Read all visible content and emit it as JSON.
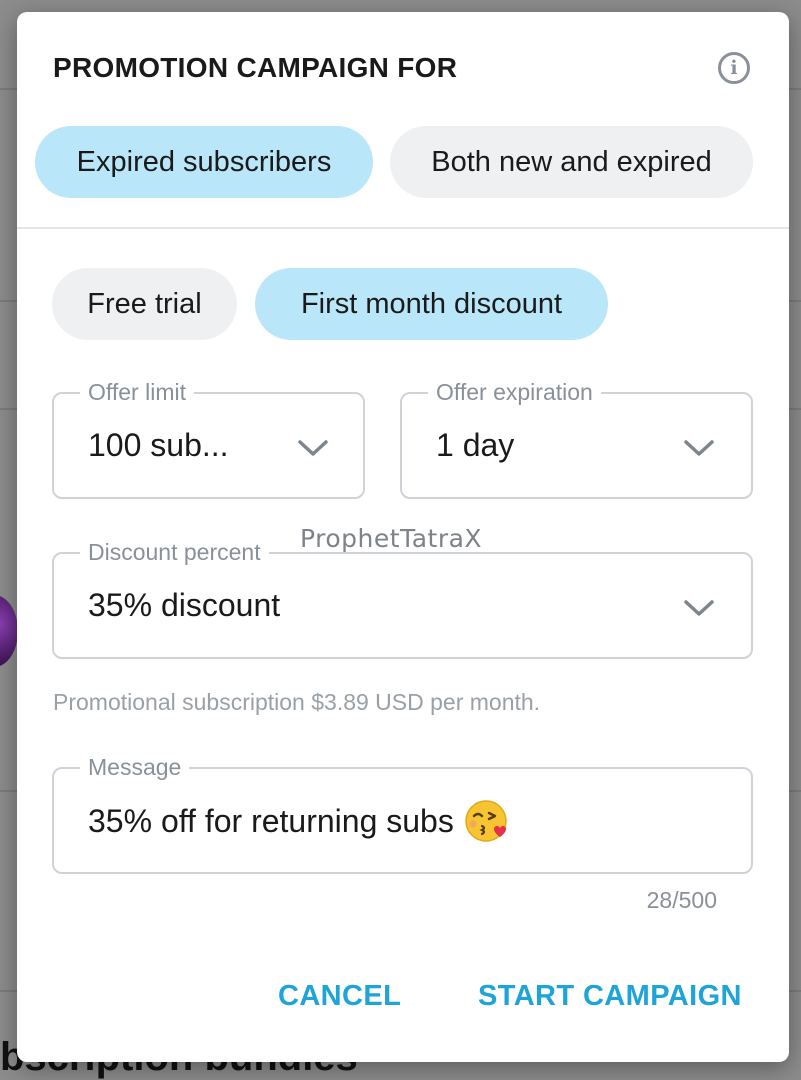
{
  "dialog": {
    "title": "PROMOTION CAMPAIGN FOR",
    "info_icon": "info-icon",
    "audience": [
      {
        "label": "Expired subscribers",
        "selected": true
      },
      {
        "label": "Both new and expired",
        "selected": false
      }
    ],
    "offer_type": [
      {
        "label": "Free trial",
        "selected": false
      },
      {
        "label": "First month discount",
        "selected": true
      }
    ],
    "offer_limit": {
      "label": "Offer limit",
      "value": "100 sub..."
    },
    "offer_expiration": {
      "label": "Offer expiration",
      "value": "1 day"
    },
    "discount_percent": {
      "label": "Discount percent",
      "value": "35% discount"
    },
    "helper_text": "Promotional subscription $3.89 USD per month.",
    "message": {
      "label": "Message",
      "value": "35% off for returning subs",
      "emoji": "kissing-face-emoji",
      "counter": "28/500"
    },
    "cancel_label": "CANCEL",
    "start_label": "START CAMPAIGN"
  },
  "watermark": "ProphetTatraX",
  "background": {
    "bottom_text": "bscription bundles"
  },
  "colors": {
    "accent": "#1ea4d6",
    "chip_selected": "#b9e6f8",
    "chip_default": "#eff0f2"
  }
}
